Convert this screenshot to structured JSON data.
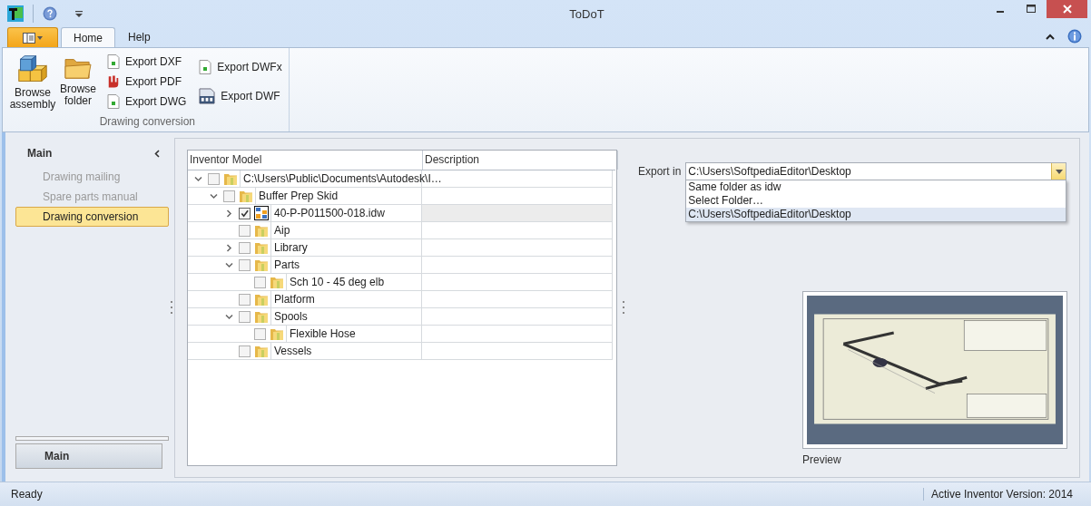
{
  "window": {
    "title": "ToDoT"
  },
  "ribbon": {
    "tabs": [
      {
        "label": "Home",
        "selected": true
      },
      {
        "label": "Help",
        "selected": false
      }
    ],
    "groups": [
      {
        "label": "Drawing conversion",
        "buttons": [
          {
            "label": "Browse assembly",
            "kind": "assembly"
          },
          {
            "label": "Browse folder",
            "kind": "folder"
          },
          {
            "label": "Export DXF",
            "kind": "page"
          },
          {
            "label": "Export PDF",
            "kind": "pdf"
          },
          {
            "label": "Export DWG",
            "kind": "page"
          },
          {
            "label": "Export DWFx",
            "kind": "page"
          },
          {
            "label": "Export DWF",
            "kind": "dwf"
          }
        ]
      }
    ]
  },
  "sidebar": {
    "title": "Main",
    "items": [
      {
        "label": "Drawing mailing",
        "selected": false
      },
      {
        "label": "Spare parts manual",
        "selected": false
      },
      {
        "label": "Drawing conversion",
        "selected": true
      }
    ],
    "footer_button": "Main"
  },
  "tree": {
    "columns": [
      "Inventor Model",
      "Description"
    ],
    "rows": [
      {
        "label": "C:\\Users\\Public\\Documents\\Autodesk\\I…",
        "kind": "folder",
        "checked": false,
        "selected": false,
        "expanded": true,
        "children": [
          {
            "label": "Buffer Prep Skid",
            "kind": "folder",
            "checked": false,
            "selected": false,
            "expanded": true,
            "children": [
              {
                "label": "40-P-P011500-018.idw",
                "kind": "drawing",
                "checked": true,
                "selected": true,
                "expanded": false
              },
              {
                "label": "Aip",
                "kind": "folder",
                "checked": false,
                "selected": false
              },
              {
                "label": "Library",
                "kind": "folder",
                "checked": false,
                "selected": false,
                "expanded": false
              },
              {
                "label": "Parts",
                "kind": "folder",
                "checked": false,
                "selected": false,
                "expanded": true,
                "children": [
                  {
                    "label": "Sch 10 - 45 deg elb",
                    "kind": "folder",
                    "checked": false,
                    "selected": false
                  }
                ]
              },
              {
                "label": "Platform",
                "kind": "folder",
                "checked": false,
                "selected": false
              },
              {
                "label": "Spools",
                "kind": "folder",
                "checked": false,
                "selected": false,
                "expanded": true,
                "children": [
                  {
                    "label": "Flexible Hose",
                    "kind": "folder",
                    "checked": false,
                    "selected": false
                  }
                ]
              },
              {
                "label": "Vessels",
                "kind": "folder",
                "checked": false,
                "selected": false
              }
            ]
          }
        ]
      }
    ]
  },
  "export": {
    "label": "Export in",
    "value": "C:\\Users\\SoftpediaEditor\\Desktop",
    "options": [
      {
        "label": "Same folder as idw",
        "selected": false
      },
      {
        "label": "Select Folder…",
        "selected": false
      },
      {
        "label": "C:\\Users\\SoftpediaEditor\\Desktop",
        "selected": true
      }
    ]
  },
  "preview": {
    "label": "Preview",
    "kind": "picture"
  },
  "status_bar": {
    "left": "Ready",
    "right": "Active Inventor Version: 2014"
  }
}
